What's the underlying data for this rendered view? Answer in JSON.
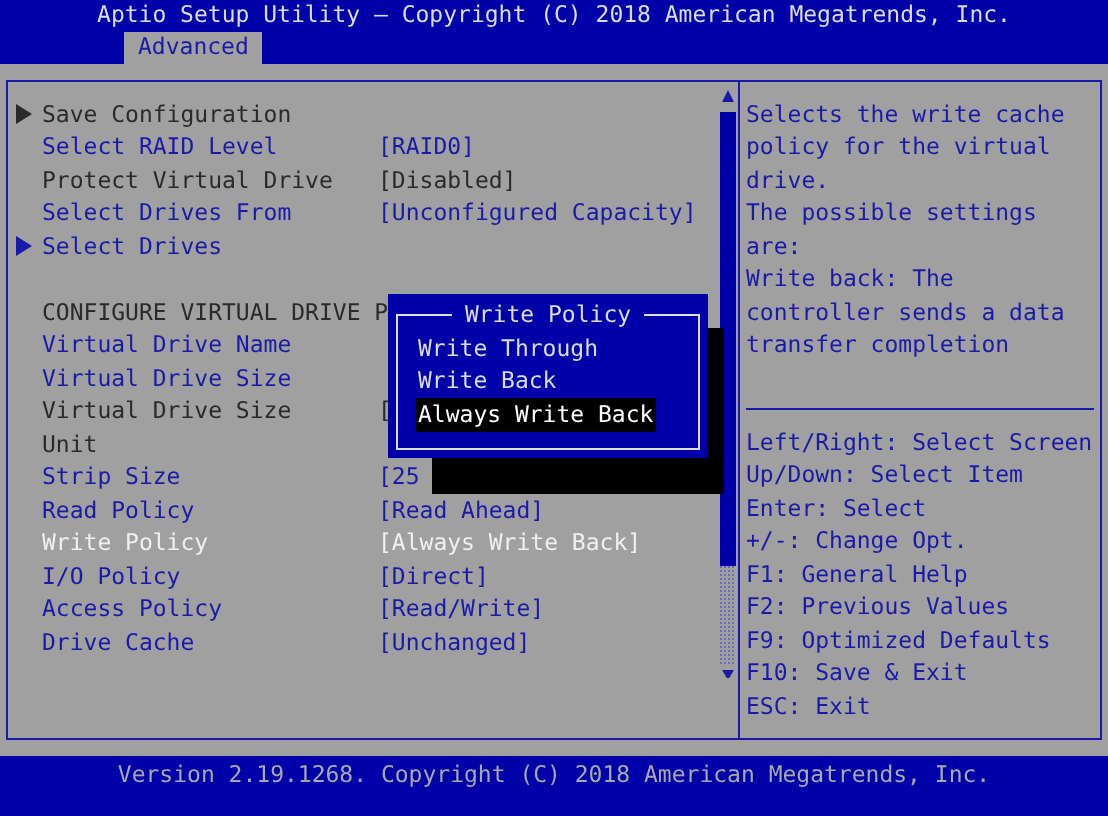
{
  "title_bar": {
    "title": "Aptio Setup Utility – Copyright (C) 2018 American Megatrends, Inc."
  },
  "tabs": [
    {
      "label": "Advanced",
      "selected": true
    }
  ],
  "settings": [
    {
      "kind": "submenu",
      "label": "Save Configuration",
      "active": false,
      "selected": false
    },
    {
      "kind": "setting",
      "label": "Select RAID Level",
      "value": "[RAID0]",
      "active": true,
      "selected": false
    },
    {
      "kind": "setting",
      "label": "Protect Virtual Drive",
      "value": "[Disabled]",
      "active": false,
      "selected": false
    },
    {
      "kind": "setting",
      "label": "Select Drives From",
      "value": "[Unconfigured Capacity]",
      "active": true,
      "selected": false
    },
    {
      "kind": "submenu",
      "label": "Select Drives",
      "active": true,
      "selected": false
    },
    {
      "kind": "blank"
    },
    {
      "kind": "heading",
      "label": "CONFIGURE VIRTUAL DRIVE P"
    },
    {
      "kind": "setting",
      "label": "Virtual Drive Name",
      "active": true,
      "selected": false
    },
    {
      "kind": "setting",
      "label": "Virtual Drive Size",
      "active": true,
      "selected": false
    },
    {
      "kind": "setting",
      "label": "Virtual Drive Size",
      "value": "[",
      "active": false,
      "selected": false
    },
    {
      "kind": "setting",
      "label": "Unit",
      "active": false,
      "selected": false
    },
    {
      "kind": "setting",
      "label": "Strip Size",
      "value": "[25",
      "active": true,
      "selected": false
    },
    {
      "kind": "setting",
      "label": "Read Policy",
      "value": "[Read Ahead]",
      "active": true,
      "selected": false
    },
    {
      "kind": "setting",
      "label": "Write Policy",
      "value": "[Always Write Back]",
      "active": true,
      "selected": true
    },
    {
      "kind": "setting",
      "label": "I/O Policy",
      "value": "[Direct]",
      "active": true,
      "selected": false
    },
    {
      "kind": "setting",
      "label": "Access Policy",
      "value": "[Read/Write]",
      "active": true,
      "selected": false
    },
    {
      "kind": "setting",
      "label": "Drive Cache",
      "value": "[Unchanged]",
      "active": true,
      "selected": false
    }
  ],
  "popup": {
    "title": "Write Policy",
    "options": [
      {
        "label": "Write Through",
        "selected": false
      },
      {
        "label": "Write Back",
        "selected": false
      },
      {
        "label": "Always Write Back",
        "selected": true
      }
    ]
  },
  "help_lines": [
    "Selects the write cache",
    "policy for the virtual",
    "drive.",
    "The possible settings",
    "are:",
    "Write back: The",
    "controller sends a data",
    "transfer completion"
  ],
  "key_hints": [
    "Left/Right: Select Screen",
    "Up/Down: Select Item",
    "Enter: Select",
    "+/-: Change Opt.",
    "F1: General Help",
    "F2: Previous Values",
    "F9: Optimized Defaults",
    "F10: Save & Exit",
    "ESC: Exit"
  ],
  "footer": {
    "text": "Version 2.19.1268. Copyright (C) 2018 American Megatrends, Inc."
  }
}
